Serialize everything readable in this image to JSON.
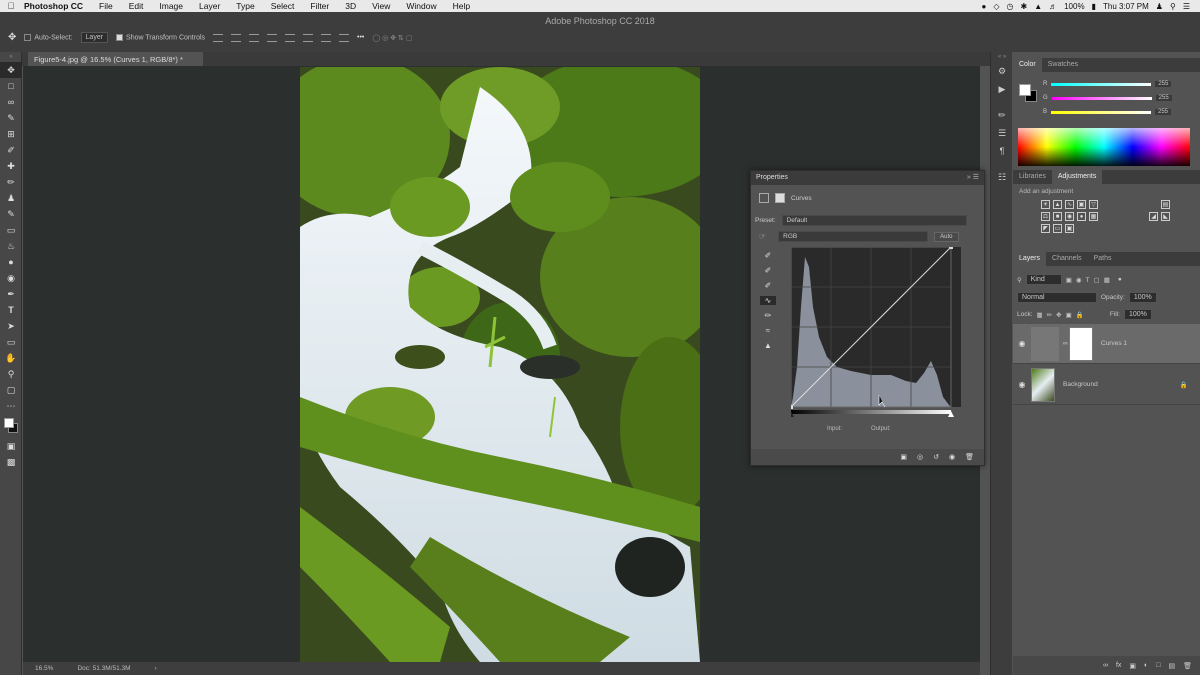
{
  "menubar": {
    "app": "Photoshop CC",
    "menus": [
      "File",
      "Edit",
      "Image",
      "Layer",
      "Type",
      "Select",
      "Filter",
      "3D",
      "View",
      "Window",
      "Help"
    ],
    "battery": "100%",
    "clock": "Thu 3:07 PM"
  },
  "window_title": "Adobe Photoshop CC 2018",
  "options": {
    "auto_select": "Auto-Select:",
    "auto_select_target": "Layer",
    "show_transform": "Show Transform Controls"
  },
  "document_tab": "Figure5-4.jpg @ 16.5% (Curves 1, RGB/8*) *",
  "statusbar": {
    "zoom": "16.5%",
    "doc": "Doc: 51.3M/51.3M"
  },
  "color_panel": {
    "tabs": [
      "Color",
      "Swatches"
    ],
    "r": {
      "label": "R",
      "value": "255"
    },
    "g": {
      "label": "G",
      "value": "255"
    },
    "b": {
      "label": "B",
      "value": "255"
    },
    "colors": {
      "r": "#ff3030",
      "g": "#30ff30",
      "b": "#5050ff"
    }
  },
  "adjust_panel": {
    "tabs": [
      "Libraries",
      "Adjustments"
    ],
    "hint": "Add an adjustment"
  },
  "layers_panel": {
    "tabs": [
      "Layers",
      "Channels",
      "Paths"
    ],
    "kind": "Kind",
    "blend_mode": "Normal",
    "opacity_label": "Opacity:",
    "opacity": "100%",
    "lock_label": "Lock:",
    "fill_label": "Fill:",
    "fill": "100%",
    "layers": [
      {
        "name": "Curves 1",
        "selected": true
      },
      {
        "name": "Background",
        "selected": false
      }
    ]
  },
  "properties": {
    "title": "Properties",
    "type": "Curves",
    "preset_label": "Preset:",
    "preset": "Default",
    "channel": "RGB",
    "auto": "Auto",
    "input": "Input:",
    "output": "Output:",
    "curve_points": [
      [
        0,
        0
      ],
      [
        255,
        255
      ]
    ]
  }
}
